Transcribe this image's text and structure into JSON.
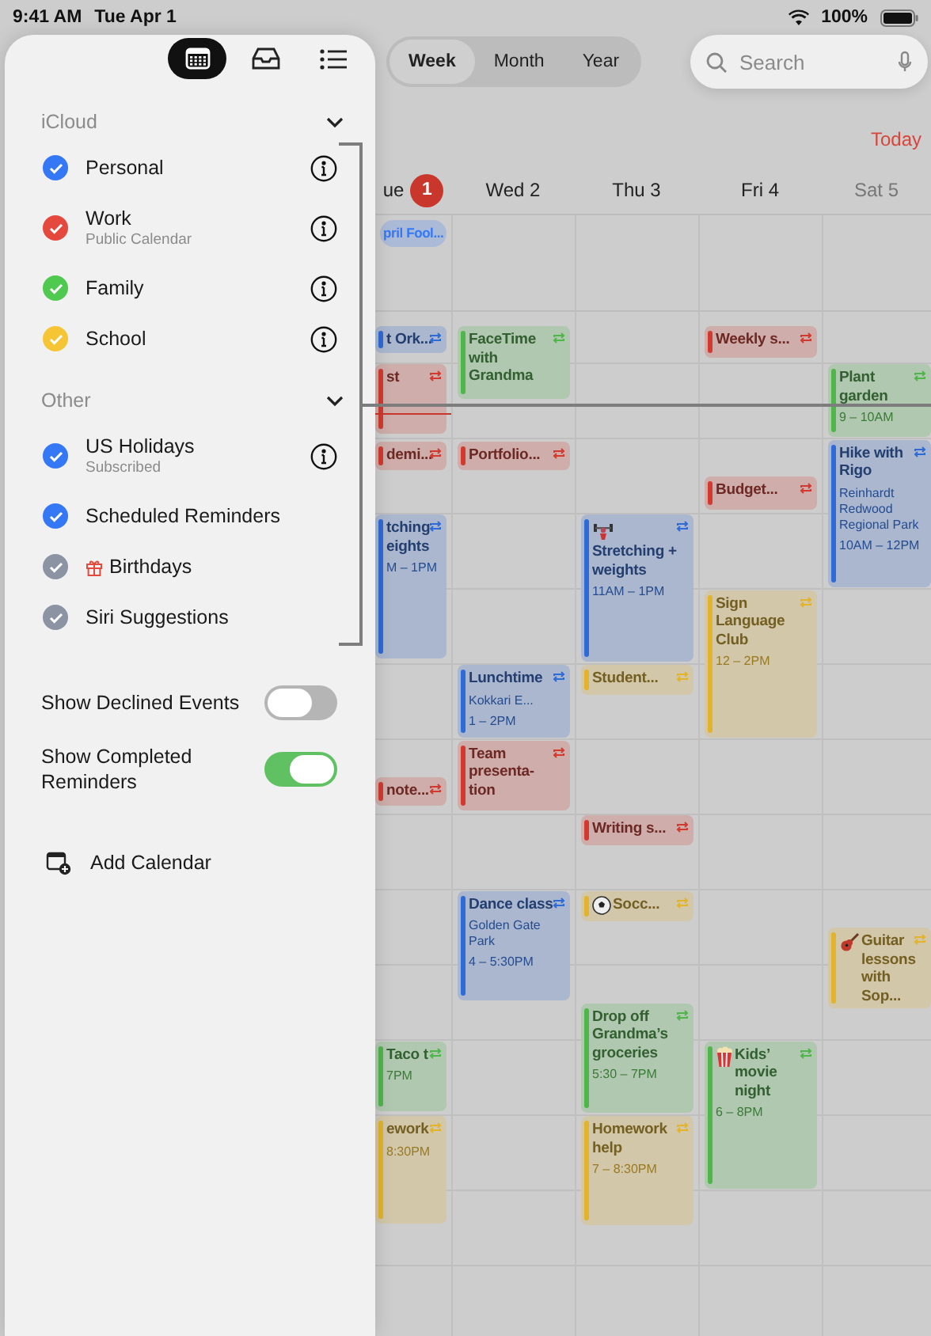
{
  "status_bar": {
    "time": "9:41 AM",
    "date": "Tue Apr 1",
    "battery": "100%"
  },
  "sidebar": {
    "view_buttons": [
      {
        "selected": true
      },
      {
        "selected": false
      },
      {
        "selected": false
      }
    ],
    "sections": [
      {
        "title": "iCloud",
        "expanded": true,
        "items": [
          {
            "name": "Personal",
            "color": "#3478f6",
            "checked": true,
            "info": true
          },
          {
            "name": "Work",
            "subtitle": "Public Calendar",
            "color": "#e5483c",
            "checked": true,
            "info": true
          },
          {
            "name": "Family",
            "color": "#4fc94f",
            "checked": true,
            "info": true
          },
          {
            "name": "School",
            "color": "#f5c535",
            "checked": true,
            "info": true
          }
        ]
      },
      {
        "title": "Other",
        "expanded": true,
        "items": [
          {
            "name": "US Holidays",
            "subtitle": "Subscribed",
            "color": "#3478f6",
            "checked": true,
            "info": true
          },
          {
            "name": "Scheduled Reminders",
            "color": "#3478f6",
            "checked": true,
            "info": false
          },
          {
            "name": "Birthdays",
            "color": "#8c93a3",
            "checked": true,
            "info": false
          },
          {
            "name": "Siri Suggestions",
            "color": "#8c93a3",
            "checked": true,
            "info": false
          }
        ]
      }
    ],
    "toggles": [
      {
        "label": "Show Declined Events",
        "on": false
      },
      {
        "label": "Show Completed Reminders",
        "on": true
      }
    ],
    "add_calendar": "Add Calendar"
  },
  "view_tabs": [
    {
      "label": "Week",
      "selected": true
    },
    {
      "label": "Month",
      "selected": false
    },
    {
      "label": "Year",
      "selected": false
    }
  ],
  "search": {
    "placeholder": "Search"
  },
  "today_button": "Today",
  "days": [
    {
      "label": "ue",
      "badge": "1",
      "weekend": false,
      "all_day": [
        {
          "title": "pril Fool...",
          "color": "#3478f6"
        }
      ],
      "events": [
        {
          "title": "t Ork...",
          "color": "#2f6bd6",
          "repeats": true
        },
        {
          "title": "st",
          "color": "#d33a2f",
          "repeats": true
        },
        {
          "title": "demi...",
          "color": "#d33a2f",
          "repeats": true
        },
        {
          "title": "tching eights",
          "time": "M – 1PM",
          "color": "#2f6bd6",
          "repeats": true
        },
        {
          "title": "note...",
          "color": "#d33a2f",
          "repeats": true
        },
        {
          "title": "Taco t",
          "time": "7PM",
          "color": "#4fb64a",
          "repeats": true
        },
        {
          "title": "ework",
          "time": "8:30PM",
          "color": "#e2b32b",
          "repeats": true
        }
      ]
    },
    {
      "label": "Wed 2",
      "weekend": false,
      "events": [
        {
          "title": "FaceTime with Grandma",
          "color": "#4fb64a",
          "repeats": true
        },
        {
          "title": "Portfolio...",
          "color": "#d33a2f",
          "repeats": true
        },
        {
          "title": "Lunchtime",
          "location": "Kokkari E...",
          "time": "1 – 2PM",
          "color": "#2f6bd6",
          "repeats": true
        },
        {
          "title": "Team presenta-tion",
          "color": "#d33a2f",
          "repeats": true
        },
        {
          "title": "Dance class",
          "location": "Golden Gate Park",
          "time": "4 – 5:30PM",
          "color": "#2f6bd6",
          "repeats": true
        }
      ]
    },
    {
      "label": "Thu 3",
      "weekend": false,
      "events": [
        {
          "title": "Stretching + weights",
          "time": "11AM – 1PM",
          "color": "#2f6bd6",
          "repeats": true
        },
        {
          "title": "Student...",
          "color": "#e2b32b",
          "repeats": true
        },
        {
          "title": "Writing s...",
          "color": "#d33a2f",
          "repeats": true
        },
        {
          "title": "Socc...",
          "color": "#e2b32b",
          "repeats": true
        },
        {
          "title": "Drop off Grandma’s groceries",
          "time": "5:30 – 7PM",
          "color": "#4fb64a",
          "repeats": true
        },
        {
          "title": "Homework help",
          "time": "7 – 8:30PM",
          "color": "#e2b32b",
          "repeats": true
        }
      ]
    },
    {
      "label": "Fri 4",
      "weekend": false,
      "events": [
        {
          "title": "Weekly s...",
          "color": "#d33a2f",
          "repeats": true
        },
        {
          "title": "Budget...",
          "color": "#d33a2f",
          "repeats": true
        },
        {
          "title": "Sign Language Club",
          "time": "12 – 2PM",
          "color": "#e2b32b",
          "repeats": true
        },
        {
          "title": "Kids’ movie night",
          "time": "6 – 8PM",
          "color": "#4fb64a",
          "repeats": true
        }
      ]
    },
    {
      "label": "Sat 5",
      "weekend": true,
      "events": [
        {
          "title": "Plant garden",
          "time": "9 – 10AM",
          "color": "#4fb64a",
          "repeats": true
        },
        {
          "title": "Hike with Rigo",
          "location": "Reinhardt Redwood Regional Park",
          "time": "10AM – 12PM",
          "color": "#2f6bd6",
          "repeats": true
        },
        {
          "title": "Guitar lessons with Sop...",
          "color": "#e2b32b",
          "repeats": true
        }
      ]
    }
  ]
}
